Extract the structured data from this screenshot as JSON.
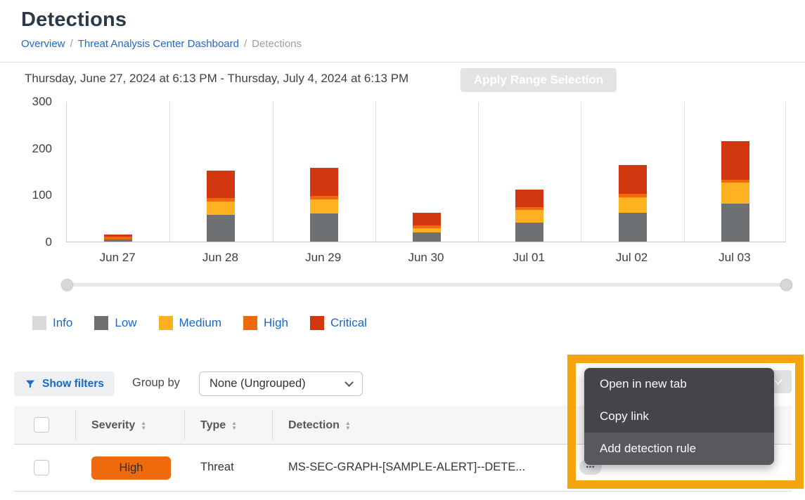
{
  "header": {
    "title": "Detections",
    "breadcrumb": [
      {
        "label": "Overview",
        "link": true
      },
      {
        "label": "Threat Analysis Center Dashboard",
        "link": true
      },
      {
        "label": "Detections",
        "link": false
      }
    ],
    "breadcrumb_separator": "/"
  },
  "toolbar": {
    "date_range": "Thursday, June 27, 2024 at 6:13 PM - Thursday, July 4, 2024 at 6:13 PM",
    "apply_button_label": "Apply Range Selection"
  },
  "chart_data": {
    "type": "bar",
    "stacked": true,
    "categories": [
      "Jun 27",
      "Jun 28",
      "Jun 29",
      "Jun 30",
      "Jul 01",
      "Jul 02",
      "Jul 03"
    ],
    "series": [
      {
        "name": "Info",
        "color": "#D9D9DB",
        "values": [
          0,
          0,
          0,
          0,
          0,
          0,
          0
        ]
      },
      {
        "name": "Low",
        "color": "#6E7174",
        "values": [
          4,
          57,
          60,
          19,
          40,
          62,
          81
        ]
      },
      {
        "name": "Medium",
        "color": "#FFB121",
        "values": [
          0,
          29,
          30,
          9,
          27,
          33,
          45
        ]
      },
      {
        "name": "High",
        "color": "#F0690C",
        "values": [
          7,
          7,
          7,
          6,
          6,
          7,
          6
        ]
      },
      {
        "name": "Critical",
        "color": "#D23710",
        "values": [
          4,
          59,
          61,
          27,
          38,
          61,
          82
        ]
      }
    ],
    "title": "",
    "xlabel": "",
    "ylabel": "",
    "ylim": [
      0,
      300
    ],
    "yticks": [
      0,
      100,
      200,
      300
    ],
    "grid": "vertical-only",
    "legend_position": "bottom",
    "legend_label_color": "#1968C8"
  },
  "filter_bar": {
    "show_filters_label": "Show filters",
    "group_by_label": "Group by",
    "group_by_value": "None (Ungrouped)"
  },
  "table": {
    "columns": [
      "Severity",
      "Type",
      "Detection"
    ],
    "rows": [
      {
        "severity": "High",
        "severity_color": "#EE6A0C",
        "type": "Threat",
        "detection": "MS-SEC-GRAPH-[SAMPLE-ALERT]--DETE..."
      }
    ]
  },
  "context_menu": {
    "items": [
      "Open in new tab",
      "Copy link",
      "Add detection rule"
    ],
    "highlighted_index": 2
  },
  "annotation": {
    "highlight_color": "#F2A50C"
  }
}
